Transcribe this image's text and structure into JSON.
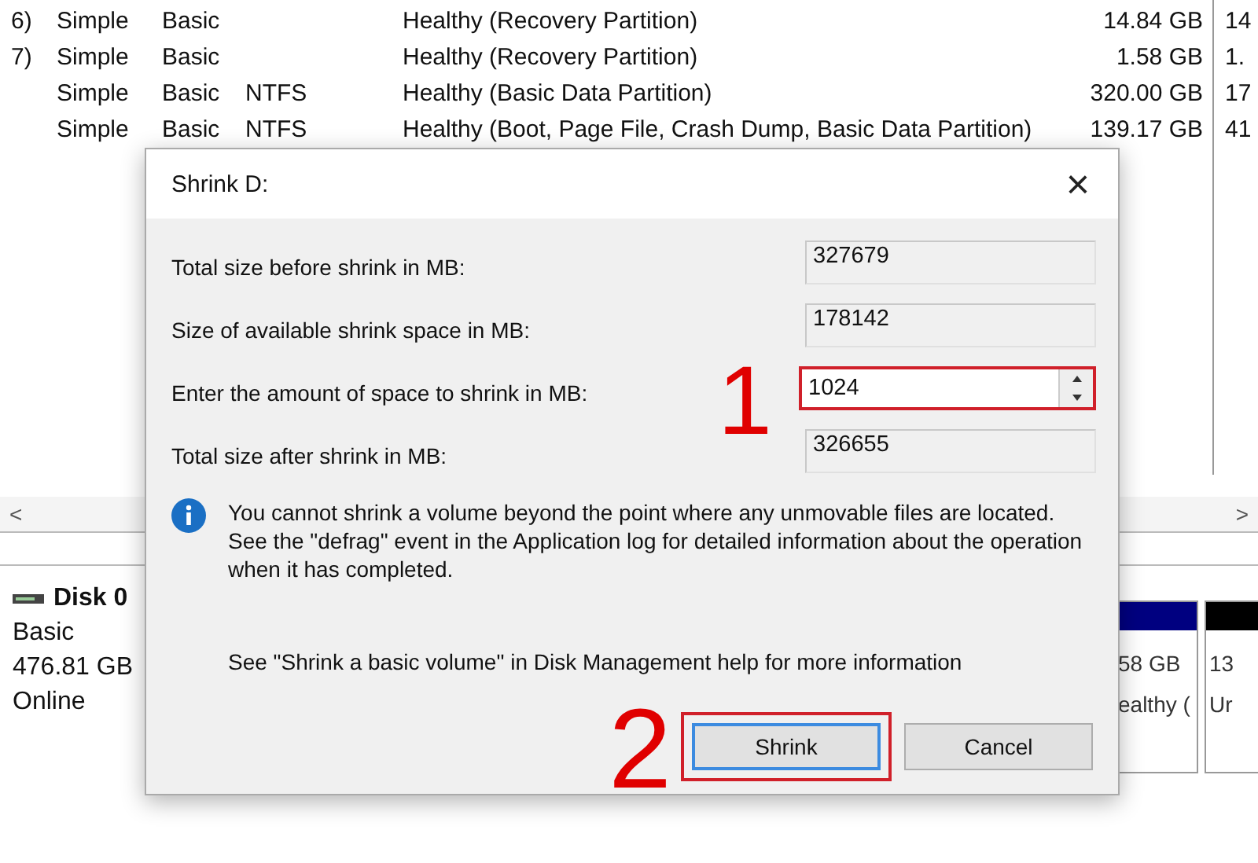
{
  "volumes": {
    "rows": [
      {
        "column_1": "6)",
        "layout": "Simple",
        "type": "Basic",
        "status": "Healthy (Recovery Partition)",
        "capacity": "14.84 GB",
        "column_7": "14"
      },
      {
        "column_1": "7)",
        "layout": "Simple",
        "type": "Basic",
        "status": "Healthy (Recovery Partition)",
        "capacity": "1.58 GB",
        "column_7": "1."
      },
      {
        "layout": "Simple",
        "type": "Basic",
        "file_system": "NTFS",
        "status": "Healthy (Basic Data Partition)",
        "capacity": "320.00 GB",
        "column_7": "17"
      },
      {
        "layout": "Simple",
        "type": "Basic",
        "file_system": "NTFS",
        "status": "Healthy (Boot, Page File, Crash Dump, Basic Data Partition)",
        "capacity": "139.17 GB",
        "column_7": "41"
      }
    ]
  },
  "scroll_left": "<",
  "scroll_right": ">",
  "disk": {
    "name": "Disk 0",
    "type": "Basic",
    "size": "476.81 GB",
    "status": "Online",
    "partitions": [
      {
        "color": "#000080",
        "size": "58 GB",
        "status": "ealthy ("
      },
      {
        "color": "#000000",
        "size": "13",
        "status": "Ur"
      }
    ]
  },
  "dialog": {
    "title": "Shrink D:",
    "close": "×",
    "fields": [
      {
        "kind": "readonly",
        "label": "Total size before shrink in MB:",
        "value": "327679",
        "highlighted": false
      },
      {
        "kind": "readonly",
        "label": "Size of available shrink space in MB:",
        "value": "178142",
        "highlighted": false
      },
      {
        "kind": "spin",
        "label": "Enter the amount of space to shrink in MB:",
        "value": "1024",
        "highlighted": true,
        "marker": "1"
      },
      {
        "kind": "readonly",
        "label": "Total size after shrink in MB:",
        "value": "326655",
        "highlighted": false
      }
    ],
    "info": "You cannot shrink a volume beyond the point where any unmovable files are located. See the \"defrag\" event in the Application log for detailed information about the operation when it has completed.",
    "help": "See \"Shrink a basic volume\" in Disk Management help for more information",
    "buttons": [
      {
        "label": "Shrink",
        "default": true,
        "highlighted": true,
        "marker": "2"
      },
      {
        "label": "Cancel",
        "default": false,
        "highlighted": false
      }
    ]
  }
}
